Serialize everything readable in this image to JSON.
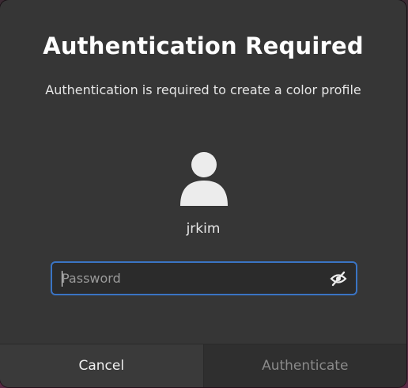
{
  "dialog": {
    "title": "Authentication Required",
    "message": "Authentication is required to create a color profile",
    "user": {
      "avatar_icon": "user-avatar-icon",
      "name": "jrkim"
    },
    "password": {
      "placeholder": "Password",
      "value": "",
      "visibility_icon": "eye-slash-icon"
    },
    "buttons": {
      "cancel_label": "Cancel",
      "authenticate_label": "Authenticate"
    }
  },
  "colors": {
    "dialog_bg": "#363636",
    "accent_focus": "#3a74c4",
    "text_primary": "#ffffff",
    "text_disabled": "#8a8a8a"
  }
}
